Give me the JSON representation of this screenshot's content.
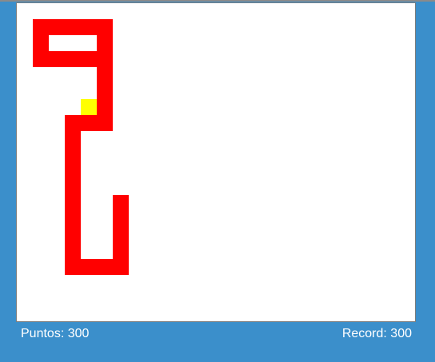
{
  "colors": {
    "background": "#3b8fcb",
    "board": "#ffffff",
    "snake": "#ff0000",
    "food": "#ffff00",
    "hud_text": "#ffffff"
  },
  "hud": {
    "score": "Puntos: 300",
    "record": "Record: 300"
  },
  "game": {
    "cell": 20,
    "snake": [
      [
        1,
        1
      ],
      [
        2,
        1
      ],
      [
        3,
        1
      ],
      [
        4,
        1
      ],
      [
        5,
        1
      ],
      [
        5,
        2
      ],
      [
        5,
        3
      ],
      [
        4,
        3
      ],
      [
        3,
        3
      ],
      [
        2,
        3
      ],
      [
        1,
        3
      ],
      [
        1,
        2
      ],
      [
        1,
        1
      ]
    ],
    "snake_path": [
      [
        1,
        1
      ],
      [
        5,
        1
      ],
      [
        5,
        3
      ],
      [
        1,
        3
      ],
      [
        1,
        1
      ]
    ],
    "snake_body": [
      [
        5,
        3
      ],
      [
        5,
        4
      ],
      [
        5,
        5
      ],
      [
        5,
        6
      ],
      [
        5,
        7
      ],
      [
        4,
        7
      ],
      [
        3,
        7
      ],
      [
        3,
        8
      ],
      [
        3,
        9
      ],
      [
        3,
        10
      ],
      [
        3,
        11
      ],
      [
        3,
        12
      ],
      [
        3,
        13
      ],
      [
        3,
        14
      ],
      [
        3,
        15
      ],
      [
        3,
        16
      ],
      [
        4,
        16
      ],
      [
        5,
        16
      ],
      [
        6,
        16
      ],
      [
        6,
        15
      ],
      [
        6,
        14
      ],
      [
        6,
        13
      ],
      [
        6,
        12
      ]
    ],
    "food": [
      4,
      6
    ]
  }
}
